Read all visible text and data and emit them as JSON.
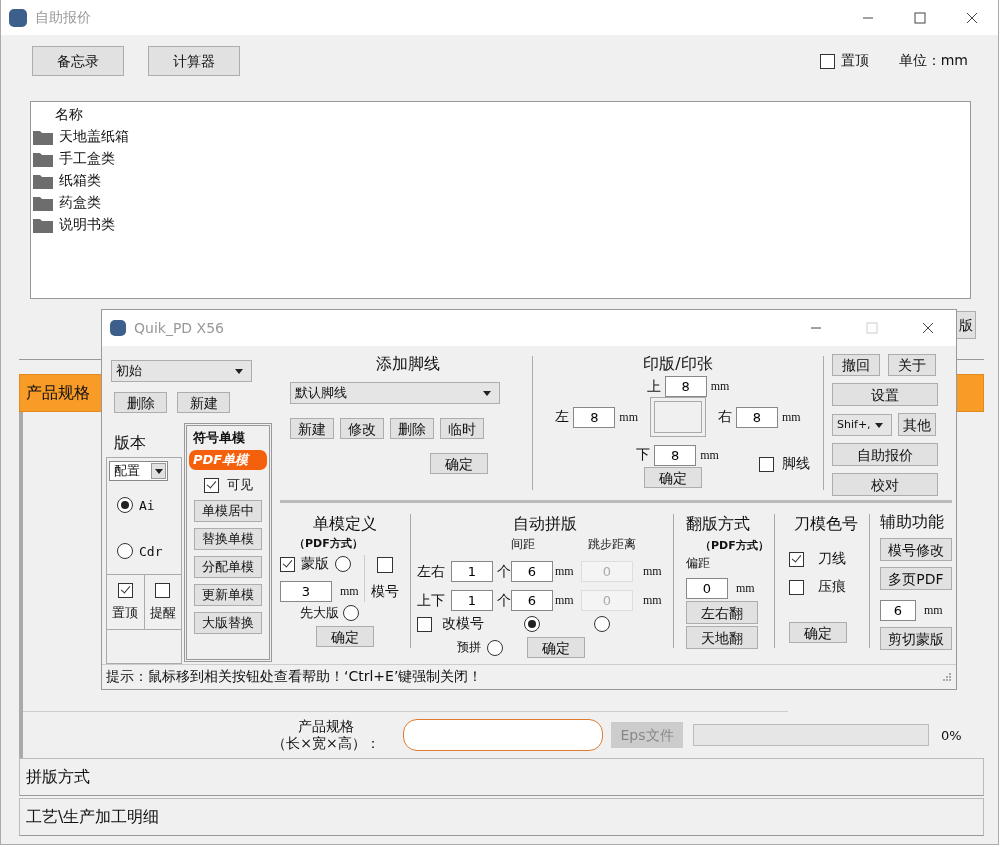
{
  "main_window": {
    "title": "自助报价"
  },
  "toolbar": {
    "buttons": [
      "备忘录",
      "计算器"
    ],
    "pin": {
      "label": "置顶",
      "checked": false
    },
    "unit": "单位：mm"
  },
  "tree": {
    "column": "名称",
    "items": [
      {
        "label": "天地盖纸箱"
      },
      {
        "label": "手工盒类"
      },
      {
        "label": "纸箱类"
      },
      {
        "label": "药盒类"
      },
      {
        "label": "说明书类"
      }
    ]
  },
  "partial_button": "版",
  "sections": [
    {
      "label": "产品规格",
      "expanded": true
    },
    {
      "label": "拼版方式",
      "expanded": false
    },
    {
      "label": "工艺\\生产加工明细",
      "expanded": false
    }
  ],
  "spec": {
    "label_1": "产品规格",
    "label_2": "（长×宽×高）：",
    "eps_button": {
      "label": "Eps文件",
      "disabled": true
    },
    "progress": {
      "level": 0,
      "reading": "0%"
    }
  },
  "dialog": {
    "title": "Quik_PD X56",
    "preset": {
      "value": "初始",
      "buttons": [
        "删除",
        "新建"
      ]
    },
    "version": {
      "label": "版本",
      "select": "配置",
      "options": [
        {
          "label": "Ai",
          "selected": true
        },
        {
          "label": "Cdr",
          "selected": false
        }
      ]
    },
    "flags": [
      {
        "label": "置顶",
        "checked": true
      },
      {
        "label": "提醒",
        "checked": false
      }
    ],
    "mode_tabs": [
      {
        "label": "符号单模",
        "selected": false
      },
      {
        "label": "PDF单模",
        "selected": true
      }
    ],
    "visible": {
      "label": "可见",
      "checked": true
    },
    "single_buttons": [
      "单模居中",
      "替换单模",
      "分配单模",
      "更新单模",
      "大版替换"
    ],
    "footline": {
      "title": "添加脚线",
      "select": "默认脚线",
      "buttons": [
        "新建",
        "修改",
        "删除",
        "临时"
      ],
      "confirm": "确定"
    },
    "plate": {
      "title": "印版/印张",
      "top": {
        "label": "上",
        "value": "8",
        "unit": "mm"
      },
      "left": {
        "label": "左",
        "value": "8",
        "unit": "mm"
      },
      "right": {
        "label": "右",
        "value": "8",
        "unit": "mm"
      },
      "bottom": {
        "label": "下",
        "value": "8",
        "unit": "mm"
      },
      "footline": {
        "label": "脚线",
        "checked": false
      },
      "confirm": "确定"
    },
    "side": {
      "undo": "撤回",
      "about": "关于",
      "settings": "设置",
      "shortcut": "Shif+,",
      "other": "其他",
      "quote": "自助报价",
      "check": "校对"
    },
    "single_def": {
      "title": "单模定义",
      "subtitle": "（PDF方式）",
      "mask": {
        "label": "蒙版",
        "checked": true,
        "radio_selected": false
      },
      "mold_no": {
        "label": "模号",
        "checked": false
      },
      "size": {
        "value": "3",
        "unit": "mm"
      },
      "first_big": {
        "label": "先大版",
        "selected": false
      },
      "confirm": "确定"
    },
    "auto": {
      "title": "自动拼版",
      "gap_label": "间距",
      "step_label": "跳步距离",
      "rows": [
        {
          "label": "左右",
          "count": "1",
          "count_unit": "个",
          "gap": "6",
          "gap_unit": "mm",
          "step": "0",
          "step_unit": "mm",
          "step_disabled": true
        },
        {
          "label": "上下",
          "count": "1",
          "count_unit": "个",
          "gap": "6",
          "gap_unit": "mm",
          "step": "0",
          "step_unit": "mm",
          "step_disabled": true
        }
      ],
      "renumber": {
        "label": "改模号",
        "checked": false
      },
      "modes": [
        {
          "selected": true
        },
        {
          "selected": false
        }
      ],
      "preview": {
        "label": "预拼",
        "selected": false
      },
      "confirm": "确定"
    },
    "flip": {
      "title": "翻版方式",
      "subtitle": "（PDF方式）",
      "offset_label": "偏距",
      "offset": {
        "value": "0",
        "unit": "mm"
      },
      "buttons": [
        "左右翻",
        "天地翻"
      ]
    },
    "knife": {
      "title": "刀模色号",
      "options": [
        {
          "label": "刀线",
          "checked": true
        },
        {
          "label": "压痕",
          "checked": false
        }
      ],
      "confirm": "确定"
    },
    "aux": {
      "title": "辅助功能",
      "buttons_top": [
        "模号修改",
        "多页PDF"
      ],
      "size": {
        "value": "6",
        "unit": "mm"
      },
      "button_bottom": "剪切蒙版"
    },
    "hint": "提示：鼠标移到相关按钮处查看帮助！‘Ctrl+E’键强制关闭！"
  }
}
